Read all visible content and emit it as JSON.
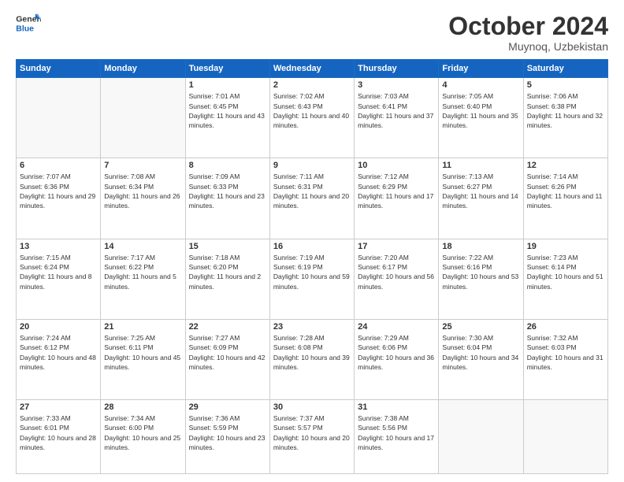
{
  "header": {
    "logo_line1": "General",
    "logo_line2": "Blue",
    "month": "October 2024",
    "location": "Muynoq, Uzbekistan"
  },
  "weekdays": [
    "Sunday",
    "Monday",
    "Tuesday",
    "Wednesday",
    "Thursday",
    "Friday",
    "Saturday"
  ],
  "weeks": [
    [
      {
        "day": "",
        "sunrise": "",
        "sunset": "",
        "daylight": ""
      },
      {
        "day": "",
        "sunrise": "",
        "sunset": "",
        "daylight": ""
      },
      {
        "day": "1",
        "sunrise": "Sunrise: 7:01 AM",
        "sunset": "Sunset: 6:45 PM",
        "daylight": "Daylight: 11 hours and 43 minutes."
      },
      {
        "day": "2",
        "sunrise": "Sunrise: 7:02 AM",
        "sunset": "Sunset: 6:43 PM",
        "daylight": "Daylight: 11 hours and 40 minutes."
      },
      {
        "day": "3",
        "sunrise": "Sunrise: 7:03 AM",
        "sunset": "Sunset: 6:41 PM",
        "daylight": "Daylight: 11 hours and 37 minutes."
      },
      {
        "day": "4",
        "sunrise": "Sunrise: 7:05 AM",
        "sunset": "Sunset: 6:40 PM",
        "daylight": "Daylight: 11 hours and 35 minutes."
      },
      {
        "day": "5",
        "sunrise": "Sunrise: 7:06 AM",
        "sunset": "Sunset: 6:38 PM",
        "daylight": "Daylight: 11 hours and 32 minutes."
      }
    ],
    [
      {
        "day": "6",
        "sunrise": "Sunrise: 7:07 AM",
        "sunset": "Sunset: 6:36 PM",
        "daylight": "Daylight: 11 hours and 29 minutes."
      },
      {
        "day": "7",
        "sunrise": "Sunrise: 7:08 AM",
        "sunset": "Sunset: 6:34 PM",
        "daylight": "Daylight: 11 hours and 26 minutes."
      },
      {
        "day": "8",
        "sunrise": "Sunrise: 7:09 AM",
        "sunset": "Sunset: 6:33 PM",
        "daylight": "Daylight: 11 hours and 23 minutes."
      },
      {
        "day": "9",
        "sunrise": "Sunrise: 7:11 AM",
        "sunset": "Sunset: 6:31 PM",
        "daylight": "Daylight: 11 hours and 20 minutes."
      },
      {
        "day": "10",
        "sunrise": "Sunrise: 7:12 AM",
        "sunset": "Sunset: 6:29 PM",
        "daylight": "Daylight: 11 hours and 17 minutes."
      },
      {
        "day": "11",
        "sunrise": "Sunrise: 7:13 AM",
        "sunset": "Sunset: 6:27 PM",
        "daylight": "Daylight: 11 hours and 14 minutes."
      },
      {
        "day": "12",
        "sunrise": "Sunrise: 7:14 AM",
        "sunset": "Sunset: 6:26 PM",
        "daylight": "Daylight: 11 hours and 11 minutes."
      }
    ],
    [
      {
        "day": "13",
        "sunrise": "Sunrise: 7:15 AM",
        "sunset": "Sunset: 6:24 PM",
        "daylight": "Daylight: 11 hours and 8 minutes."
      },
      {
        "day": "14",
        "sunrise": "Sunrise: 7:17 AM",
        "sunset": "Sunset: 6:22 PM",
        "daylight": "Daylight: 11 hours and 5 minutes."
      },
      {
        "day": "15",
        "sunrise": "Sunrise: 7:18 AM",
        "sunset": "Sunset: 6:20 PM",
        "daylight": "Daylight: 11 hours and 2 minutes."
      },
      {
        "day": "16",
        "sunrise": "Sunrise: 7:19 AM",
        "sunset": "Sunset: 6:19 PM",
        "daylight": "Daylight: 10 hours and 59 minutes."
      },
      {
        "day": "17",
        "sunrise": "Sunrise: 7:20 AM",
        "sunset": "Sunset: 6:17 PM",
        "daylight": "Daylight: 10 hours and 56 minutes."
      },
      {
        "day": "18",
        "sunrise": "Sunrise: 7:22 AM",
        "sunset": "Sunset: 6:16 PM",
        "daylight": "Daylight: 10 hours and 53 minutes."
      },
      {
        "day": "19",
        "sunrise": "Sunrise: 7:23 AM",
        "sunset": "Sunset: 6:14 PM",
        "daylight": "Daylight: 10 hours and 51 minutes."
      }
    ],
    [
      {
        "day": "20",
        "sunrise": "Sunrise: 7:24 AM",
        "sunset": "Sunset: 6:12 PM",
        "daylight": "Daylight: 10 hours and 48 minutes."
      },
      {
        "day": "21",
        "sunrise": "Sunrise: 7:25 AM",
        "sunset": "Sunset: 6:11 PM",
        "daylight": "Daylight: 10 hours and 45 minutes."
      },
      {
        "day": "22",
        "sunrise": "Sunrise: 7:27 AM",
        "sunset": "Sunset: 6:09 PM",
        "daylight": "Daylight: 10 hours and 42 minutes."
      },
      {
        "day": "23",
        "sunrise": "Sunrise: 7:28 AM",
        "sunset": "Sunset: 6:08 PM",
        "daylight": "Daylight: 10 hours and 39 minutes."
      },
      {
        "day": "24",
        "sunrise": "Sunrise: 7:29 AM",
        "sunset": "Sunset: 6:06 PM",
        "daylight": "Daylight: 10 hours and 36 minutes."
      },
      {
        "day": "25",
        "sunrise": "Sunrise: 7:30 AM",
        "sunset": "Sunset: 6:04 PM",
        "daylight": "Daylight: 10 hours and 34 minutes."
      },
      {
        "day": "26",
        "sunrise": "Sunrise: 7:32 AM",
        "sunset": "Sunset: 6:03 PM",
        "daylight": "Daylight: 10 hours and 31 minutes."
      }
    ],
    [
      {
        "day": "27",
        "sunrise": "Sunrise: 7:33 AM",
        "sunset": "Sunset: 6:01 PM",
        "daylight": "Daylight: 10 hours and 28 minutes."
      },
      {
        "day": "28",
        "sunrise": "Sunrise: 7:34 AM",
        "sunset": "Sunset: 6:00 PM",
        "daylight": "Daylight: 10 hours and 25 minutes."
      },
      {
        "day": "29",
        "sunrise": "Sunrise: 7:36 AM",
        "sunset": "Sunset: 5:59 PM",
        "daylight": "Daylight: 10 hours and 23 minutes."
      },
      {
        "day": "30",
        "sunrise": "Sunrise: 7:37 AM",
        "sunset": "Sunset: 5:57 PM",
        "daylight": "Daylight: 10 hours and 20 minutes."
      },
      {
        "day": "31",
        "sunrise": "Sunrise: 7:38 AM",
        "sunset": "Sunset: 5:56 PM",
        "daylight": "Daylight: 10 hours and 17 minutes."
      },
      {
        "day": "",
        "sunrise": "",
        "sunset": "",
        "daylight": ""
      },
      {
        "day": "",
        "sunrise": "",
        "sunset": "",
        "daylight": ""
      }
    ]
  ]
}
